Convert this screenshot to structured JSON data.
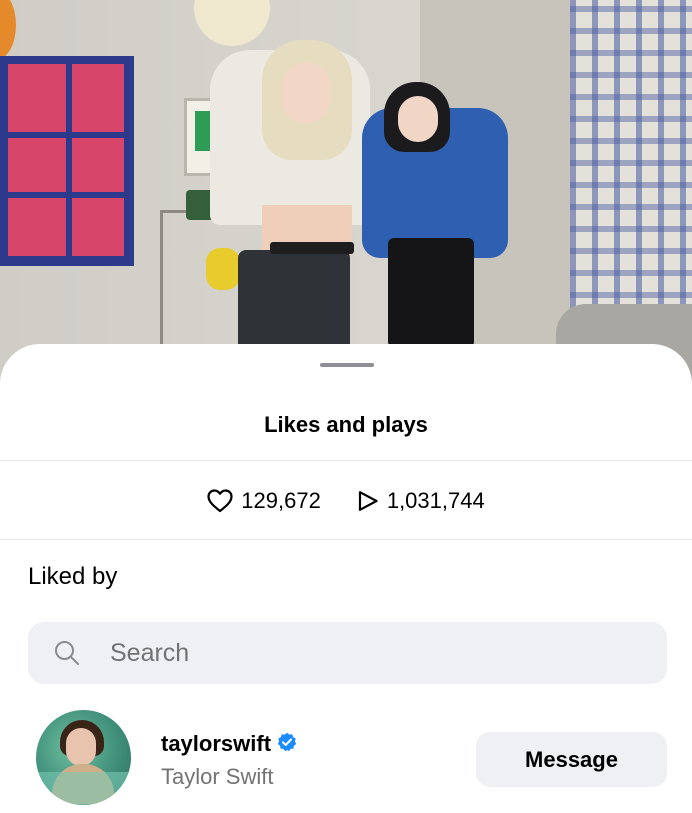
{
  "sheet": {
    "title": "Likes and plays"
  },
  "stats": {
    "likes": {
      "icon": "heart-icon",
      "value": "129,672"
    },
    "plays": {
      "icon": "play-icon",
      "value": "1,031,744"
    }
  },
  "liked_by": {
    "label": "Liked by",
    "search_placeholder": "Search",
    "users": [
      {
        "username": "taylorswift",
        "full_name": "Taylor Swift",
        "verified": true,
        "action_label": "Message"
      }
    ]
  },
  "colors": {
    "verified_badge": "#1a8cff",
    "secondary_text": "#737373",
    "field_background": "#eff0f3"
  }
}
